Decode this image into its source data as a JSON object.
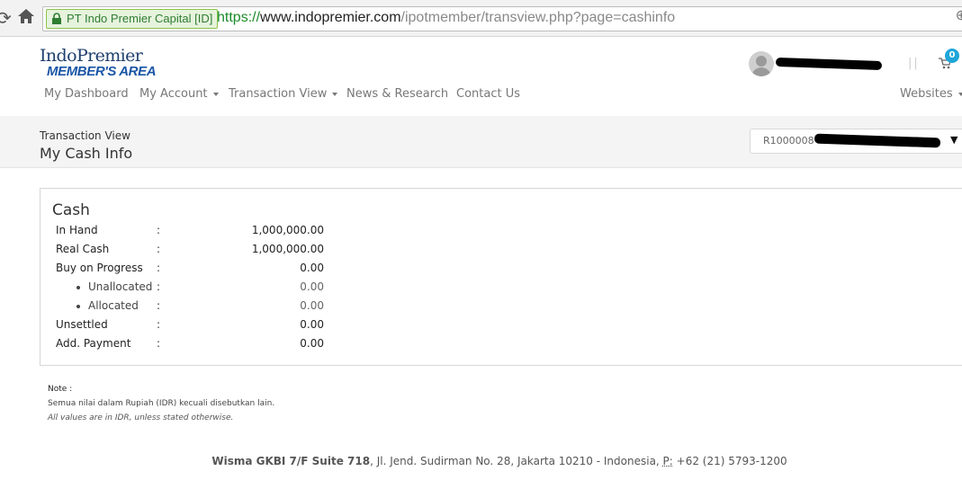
{
  "browser": {
    "ev_label": "PT Indo Premier Capital [ID]",
    "url_scheme": "https://",
    "url_host": "www.indopremier.com",
    "url_path": "/ipotmember/transview.php?page=cashinfo"
  },
  "logo": {
    "top_text": "IndoPremier",
    "bottom_text": "MEMBER'S AREA"
  },
  "nav": {
    "items": [
      {
        "label": "My Dashboard"
      },
      {
        "label": "My Account"
      },
      {
        "label": "Transaction View"
      },
      {
        "label": "News & Research"
      },
      {
        "label": "Contact Us"
      }
    ],
    "websites_label": "Websites",
    "cart_count": "0",
    "separator": "||"
  },
  "page": {
    "breadcrumb": "Transaction View",
    "title": "My Cash Info",
    "account_prefix": "R1000008"
  },
  "cash": {
    "title": "Cash",
    "rows": [
      {
        "label": "In Hand",
        "value": "1,000,000.00"
      },
      {
        "label": "Real Cash",
        "value": "1,000,000.00"
      },
      {
        "label": "Buy on Progress",
        "value": "0.00"
      },
      {
        "label": "Unallocated",
        "value": "0.00"
      },
      {
        "label": "Allocated",
        "value": "0.00"
      },
      {
        "label": "Unsettled",
        "value": "0.00"
      },
      {
        "label": "Add. Payment",
        "value": "0.00"
      }
    ],
    "colon": ":"
  },
  "note": {
    "heading": "Note :",
    "line_id": "Semua nilai dalam Rupiah (IDR) kecuali disebutkan lain.",
    "line_en": "All values are in IDR, unless stated otherwise."
  },
  "footer": {
    "building": "Wisma GKBI 7/F Suite 718",
    "address": ", Jl. Jend. Sudirman No. 28, Jakarta 10210 - Indonesia, ",
    "phone_label": "P:",
    "phone": " +62 (21) 5793-1200"
  },
  "colors": {
    "brand_navy": "#1f3f6e",
    "brand_blue": "#1a56a6",
    "badge_blue": "#1fa6d9",
    "ssl_green": "#2e7d32"
  }
}
